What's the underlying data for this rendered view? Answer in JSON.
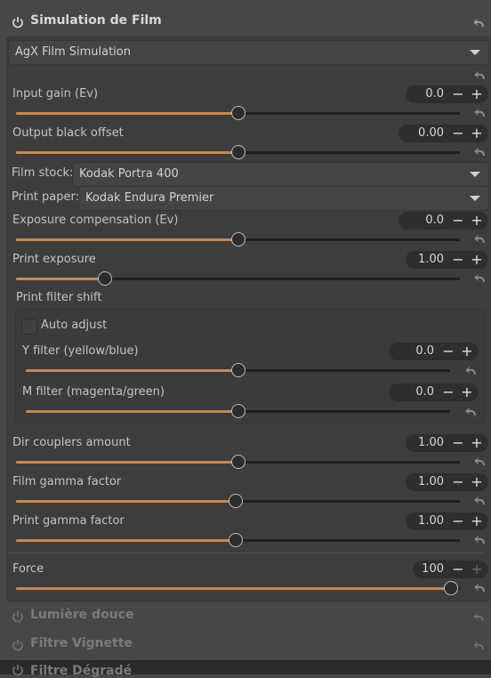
{
  "module": {
    "title": "Simulation de Film"
  },
  "preset": {
    "value": "AgX Film Simulation"
  },
  "sliders": [
    {
      "label": "Input gain (Ev)",
      "value": "0.0",
      "level": 0.5
    },
    {
      "label": "Output black offset",
      "value": "0.00",
      "level": 0.5
    },
    {
      "label": "Exposure compensation (Ev)",
      "value": "0.0",
      "level": 0.5
    },
    {
      "label": "Print exposure",
      "value": "1.00",
      "level": 0.2
    },
    {
      "label": "Dir couplers amount",
      "value": "1.00",
      "level": 0.5
    },
    {
      "label": "Film gamma factor",
      "value": "1.00",
      "level": 0.495
    },
    {
      "label": "Print gamma factor",
      "value": "1.00",
      "level": 0.495
    },
    {
      "label": "Force",
      "value": "100",
      "level": 0.98
    }
  ],
  "film_stock": {
    "label": "Film stock:",
    "value": "Kodak Portra 400"
  },
  "print_paper": {
    "label": "Print paper:",
    "value": "Kodak Endura Premier"
  },
  "filter_shift": {
    "title": "Print filter shift",
    "auto_adjust": "Auto adjust",
    "y_filter": {
      "label": "Y filter (yellow/blue)",
      "value": "0.0",
      "level": 0.5
    },
    "m_filter": {
      "label": "M filter (magenta/green)",
      "value": "0.0",
      "level": 0.5
    }
  },
  "collapsed_modules": [
    "Lumière douce",
    "Filtre Vignette",
    "Filtre Dégradé"
  ],
  "colors": {
    "accent": "#c48a52",
    "background": "#474747",
    "panel": "#3d3d3d"
  },
  "glyphs": {
    "minus": "−",
    "plus": "+"
  }
}
